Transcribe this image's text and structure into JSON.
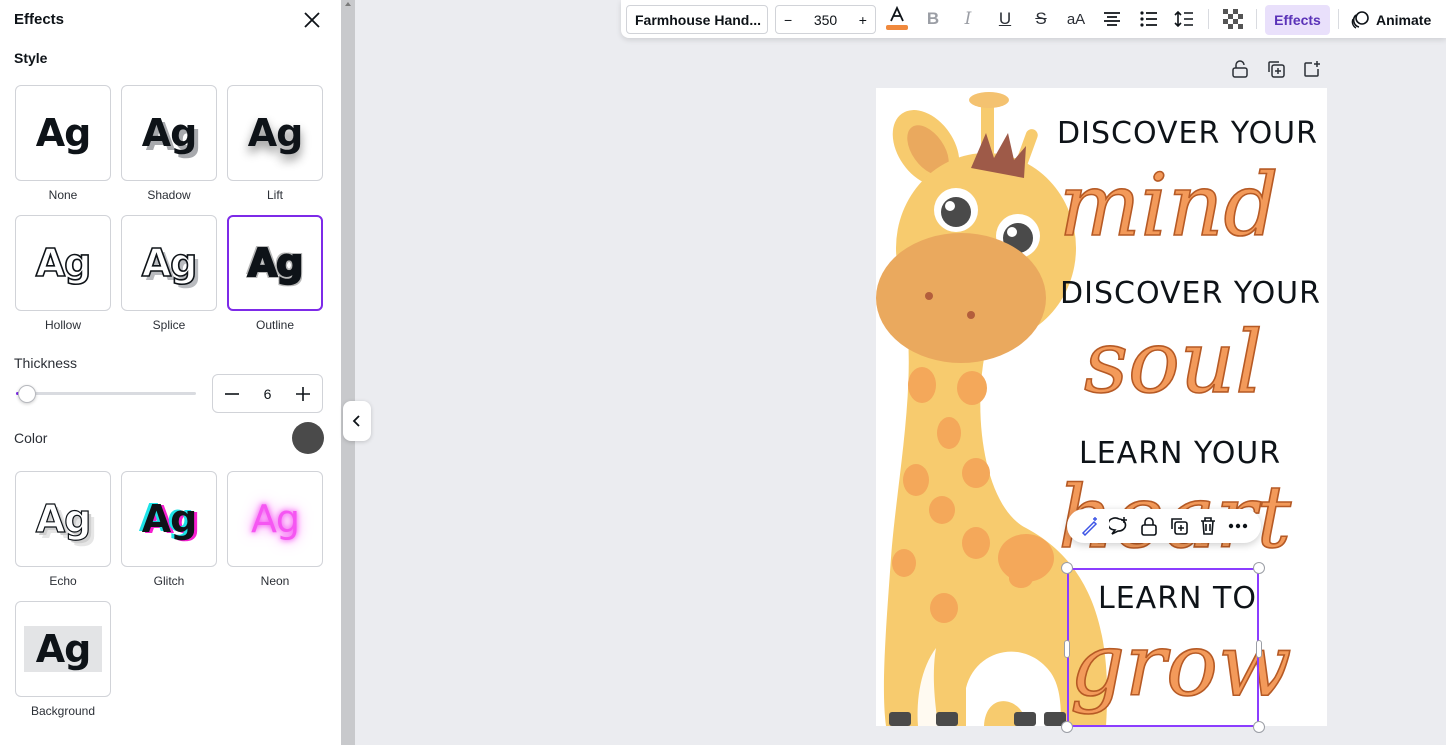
{
  "panel": {
    "title": "Effects",
    "style_heading": "Style",
    "styles": [
      {
        "label": "None",
        "sample": "Ag"
      },
      {
        "label": "Shadow",
        "sample": "Ag"
      },
      {
        "label": "Lift",
        "sample": "Ag"
      },
      {
        "label": "Hollow",
        "sample": "Ag"
      },
      {
        "label": "Splice",
        "sample": "Ag"
      },
      {
        "label": "Outline",
        "sample": "Ag"
      },
      {
        "label": "Echo",
        "sample": "Ag"
      },
      {
        "label": "Glitch",
        "sample": "Ag"
      },
      {
        "label": "Neon",
        "sample": "Ag"
      },
      {
        "label": "Background",
        "sample": "Ag"
      }
    ],
    "selected_style": "Outline",
    "thickness": {
      "label": "Thickness",
      "value": "6",
      "slider_fraction": 0.06
    },
    "color": {
      "label": "Color",
      "value": "#4a4a4a"
    }
  },
  "toolbar": {
    "font": "Farmhouse Hand...",
    "font_size": "350",
    "text_color": "#f0893d",
    "effects_label": "Effects",
    "animate_label": "Animate"
  },
  "design": {
    "line1": "DISCOVER YOUR",
    "word1": "mind",
    "line2": "DISCOVER YOUR",
    "word2": "soul",
    "line3": "LEARN YOUR",
    "word3": "heart",
    "line4": "LEARN TO",
    "word4": "grow"
  },
  "colors": {
    "accent": "#7d2ae8",
    "script_fill": "#f39a5a",
    "giraffe": "#f7cb6e"
  }
}
